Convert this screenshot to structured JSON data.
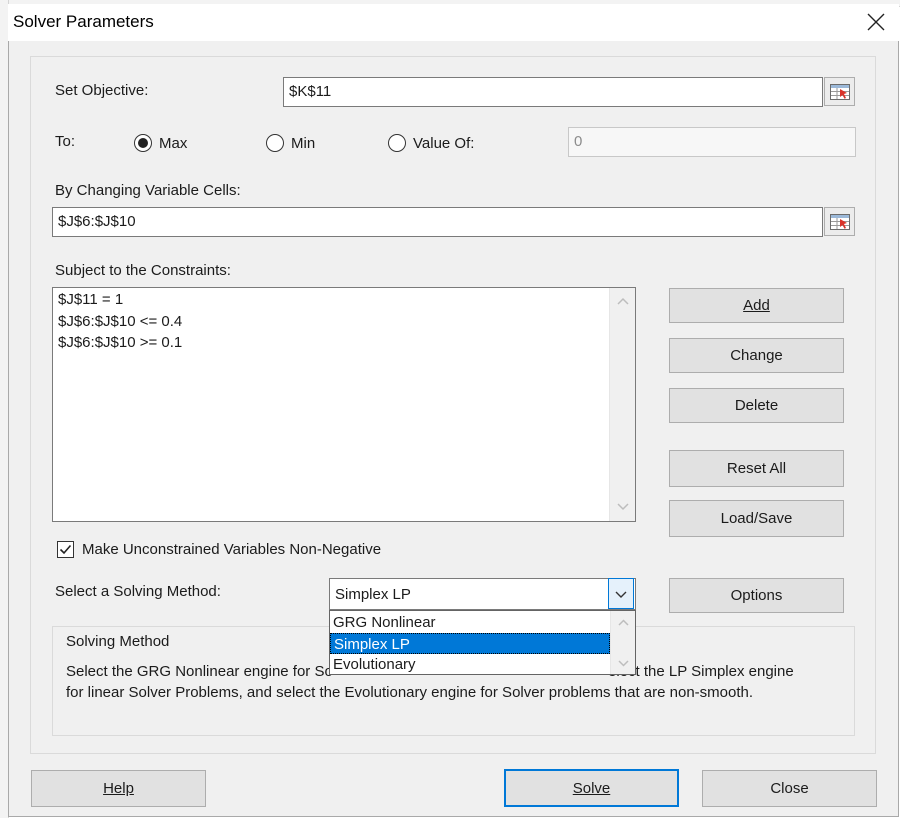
{
  "window": {
    "title": "Solver Parameters"
  },
  "objective": {
    "label": "Set Objective:",
    "value": "$K$11"
  },
  "to": {
    "label": "To:",
    "options": [
      {
        "label": "Max",
        "selected": true
      },
      {
        "label": "Min",
        "selected": false
      },
      {
        "label": "Value Of:",
        "selected": false
      }
    ],
    "value_of": "0"
  },
  "variables": {
    "label": "By Changing Variable Cells:",
    "value": "$J$6:$J$10"
  },
  "constraints": {
    "label": "Subject to the Constraints:",
    "items": [
      "$J$11 = 1",
      "$J$6:$J$10 <= 0.4",
      "$J$6:$J$10 >= 0.1"
    ]
  },
  "side_buttons": {
    "add": "Add",
    "change": "Change",
    "delete": "Delete",
    "reset_all": "Reset All",
    "load_save": "Load/Save",
    "options": "Options"
  },
  "nonnegative": {
    "label": "Make Unconstrained Variables Non-Negative",
    "checked": true
  },
  "method": {
    "label": "Select a Solving Method:",
    "selected": "Simplex LP",
    "options": [
      "GRG Nonlinear",
      "Simplex LP",
      "Evolutionary"
    ]
  },
  "solving_method": {
    "title": "Solving Method",
    "line1_start": "Select the GRG Nonlinear engine for So",
    "line1_end": "elect the LP Simplex engine",
    "line2": "for linear Solver Problems, and select the Evolutionary engine for Solver problems that are non-smooth."
  },
  "footer": {
    "help": "Help",
    "solve": "Solve",
    "close": "Close"
  },
  "colors": {
    "accent": "#0078d7",
    "dialog_bg": "#f0f0f0",
    "button_bg": "#e1e1e1"
  }
}
